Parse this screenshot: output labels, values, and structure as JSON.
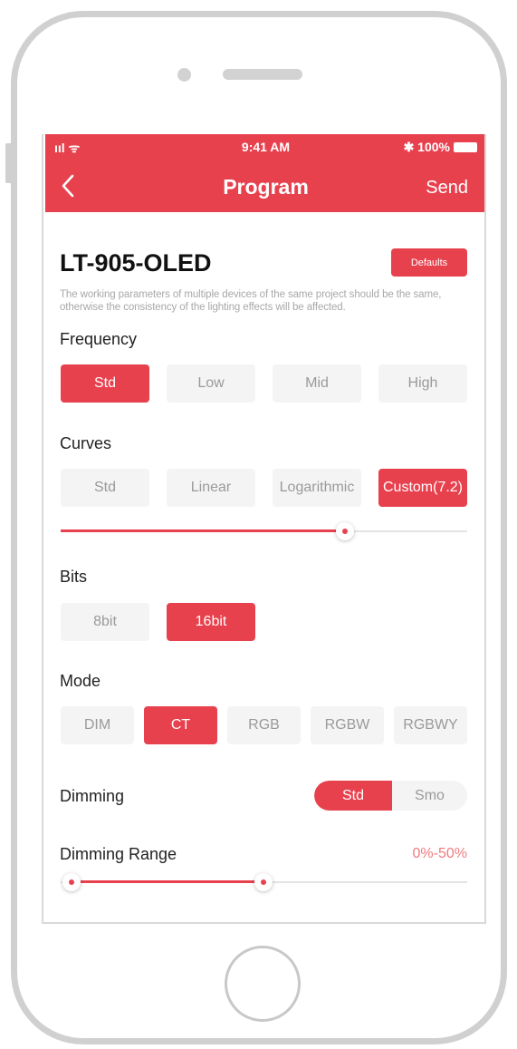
{
  "status_bar": {
    "signal": "ııl ᯤ",
    "time": "9:41 AM",
    "battery": "✱ 100%"
  },
  "nav": {
    "back_icon": "chevron-left-icon",
    "title": "Program",
    "send_label": "Send"
  },
  "device": {
    "name": "LT-905-OLED",
    "defaults_label": "Defaults",
    "note": "The working parameters of multiple devices of the same project should be the same, otherwise the consistency of the lighting effects will be affected."
  },
  "frequency": {
    "label": "Frequency",
    "options": [
      "Std",
      "Low",
      "Mid",
      "High"
    ],
    "selected": "Std"
  },
  "curves": {
    "label": "Curves",
    "options": [
      "Std",
      "Linear",
      "Logarithmic",
      "Custom(7.2)"
    ],
    "selected": "Custom(7.2)",
    "slider_fraction": 0.71
  },
  "bits": {
    "label": "Bits",
    "options": [
      "8bit",
      "16bit"
    ],
    "selected": "16bit"
  },
  "mode": {
    "label": "Mode",
    "options": [
      "DIM",
      "CT",
      "RGB",
      "RGBW",
      "RGBWY"
    ],
    "selected": "CT"
  },
  "dimming": {
    "label": "Dimming",
    "options": [
      "Std",
      "Smo"
    ],
    "selected": "Std"
  },
  "dimming_range": {
    "label": "Dimming Range",
    "value": "0%-50%",
    "low_fraction": 0.0,
    "high_fraction": 0.5
  },
  "colors": {
    "accent": "#e8414e",
    "inactive_bg": "#f4f4f4",
    "inactive_text": "#9a9a9a"
  }
}
